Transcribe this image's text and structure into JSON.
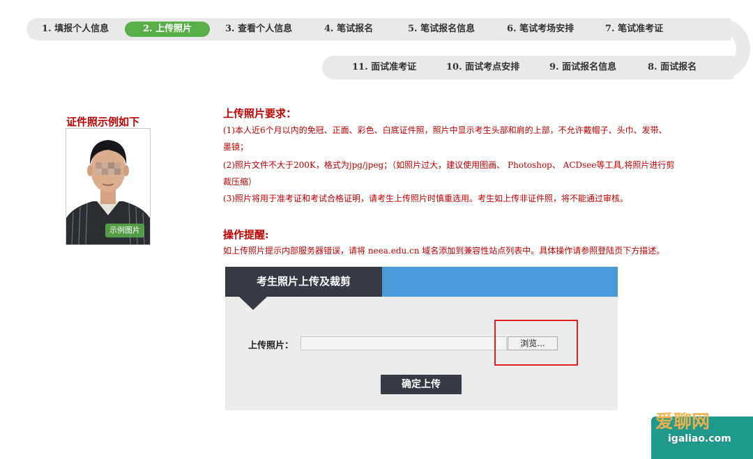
{
  "steps_row1": [
    {
      "label": "1. 填报个人信息",
      "active": false
    },
    {
      "label": "2. 上传照片",
      "active": true
    },
    {
      "label": "3. 查看个人信息",
      "active": false
    },
    {
      "label": "4. 笔试报名",
      "active": false
    },
    {
      "label": "5. 笔试报名信息",
      "active": false
    },
    {
      "label": "6. 笔试考场安排",
      "active": false
    },
    {
      "label": "7. 笔试准考证",
      "active": false
    }
  ],
  "steps_row2": [
    {
      "label": "11. 面试准考证"
    },
    {
      "label": "10. 面试考点安排"
    },
    {
      "label": "9. 面试报名信息"
    },
    {
      "label": "8. 面试报名"
    }
  ],
  "sample": {
    "title": "证件照示例如下",
    "badge": "示例图片"
  },
  "requirements": {
    "title": "上传照片要求：",
    "lines": [
      "(1)本人近6个月以内的免冠、正面、彩色、白底证件照，照片中显示考生头部和肩的上部，不允许戴帽子、头巾、发带、",
      "墨镜；",
      "(2)照片文件不大于200K，格式为jpg/jpeg；（如照片过大，建议使用图画、 Photoshop、 ACDsee等工具,将照片进行剪",
      "裁压缩）",
      "(3)照片将用于准考证和考试合格证明，请考生上传照片时慎重选用。考生如上传非证件照，将不能通过审核。"
    ]
  },
  "tips": {
    "title": "操作提醒:",
    "line": "如上传照片提示内部服务器错误，请将 neea.edu.cn 域名添加到兼容性站点列表中。具体操作请参照登陆页下方描述。"
  },
  "upload_panel": {
    "tab_title": "考生照片上传及裁剪",
    "field_label": "上传照片：",
    "file_value": "",
    "browse_label": "浏览...",
    "confirm_label": "确定上传"
  },
  "watermark": {
    "main": "爱聊网",
    "sub": "igaliao.com"
  },
  "colors": {
    "active_step": "#58ae47",
    "accent_red": "#c00000",
    "panel_dark": "#363a42",
    "panel_blue": "#4a9bd8",
    "highlight": "#e02020"
  }
}
